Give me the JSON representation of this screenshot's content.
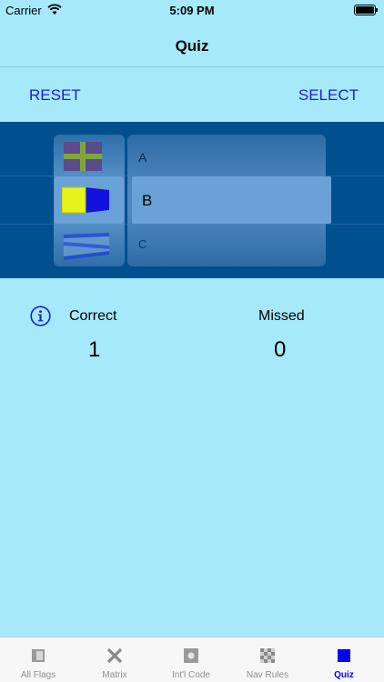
{
  "status": {
    "carrier": "Carrier",
    "time": "5:09 PM"
  },
  "nav": {
    "title": "Quiz"
  },
  "actions": {
    "reset": "RESET",
    "select": "SELECT"
  },
  "picker": {
    "selected_index": 1,
    "rows": [
      {
        "letter": "A",
        "flag": "alfa-flag"
      },
      {
        "letter": "B",
        "flag": "bravo-flag"
      },
      {
        "letter": "C",
        "flag": "charlie-flag"
      }
    ]
  },
  "score": {
    "correct_label": "Correct",
    "missed_label": "Missed",
    "correct_value": "1",
    "missed_value": "0"
  },
  "tabs": [
    {
      "label": "All Flags",
      "icon": "flag-icon"
    },
    {
      "label": "Matrix",
      "icon": "cross-icon"
    },
    {
      "label": "Int'l Code",
      "icon": "square-dot-icon"
    },
    {
      "label": "Nav Rules",
      "icon": "checker-icon"
    },
    {
      "label": "Quiz",
      "icon": "blue-square-icon",
      "active": true
    }
  ],
  "colors": {
    "background": "#a6e9fb",
    "accent": "#1a1fcf",
    "picker": "#00508f",
    "tab_active": "#0000ff",
    "tab_inactive": "#8e8e93"
  }
}
